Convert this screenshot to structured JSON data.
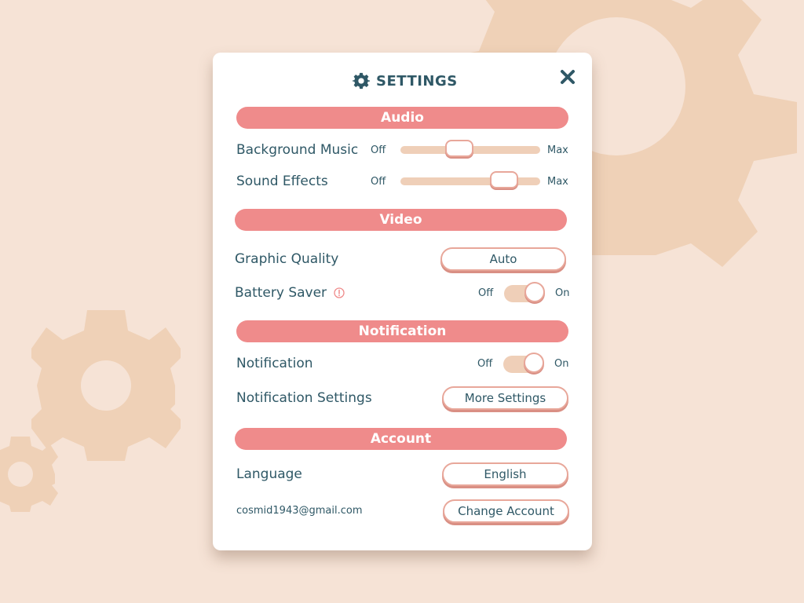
{
  "window": {
    "title": "SETTINGS"
  },
  "icons": {
    "title": "gear-icon",
    "close": "close-icon",
    "info": "info-icon"
  },
  "colors": {
    "background": "#f6e3d6",
    "decor_gear": "#efd1b7",
    "section_header": "#ef8b8b",
    "text": "#2f5866",
    "track": "#efcfb8",
    "border": "#e8a79a"
  },
  "audio": {
    "header": "Audio",
    "background_music": {
      "label": "Background Music",
      "min_label": "Off",
      "max_label": "Max",
      "value_fraction": 0.43
    },
    "sound_effects": {
      "label": "Sound Effects",
      "min_label": "Off",
      "max_label": "Max",
      "value_fraction": 0.75
    }
  },
  "video": {
    "header": "Video",
    "graphic_quality": {
      "label": "Graphic Quality",
      "value": "Auto"
    },
    "battery_saver": {
      "label": "Battery Saver",
      "off_label": "Off",
      "on_label": "On",
      "state": "on"
    }
  },
  "notification": {
    "header": "Notification",
    "notification": {
      "label": "Notification",
      "off_label": "Off",
      "on_label": "On",
      "state": "on"
    },
    "settings": {
      "label": "Notification Settings",
      "button_label": "More Settings"
    }
  },
  "account": {
    "header": "Account",
    "language": {
      "label": "Language",
      "value": "English"
    },
    "email": "cosmid1943@gmail.com",
    "change_button": "Change Account"
  }
}
